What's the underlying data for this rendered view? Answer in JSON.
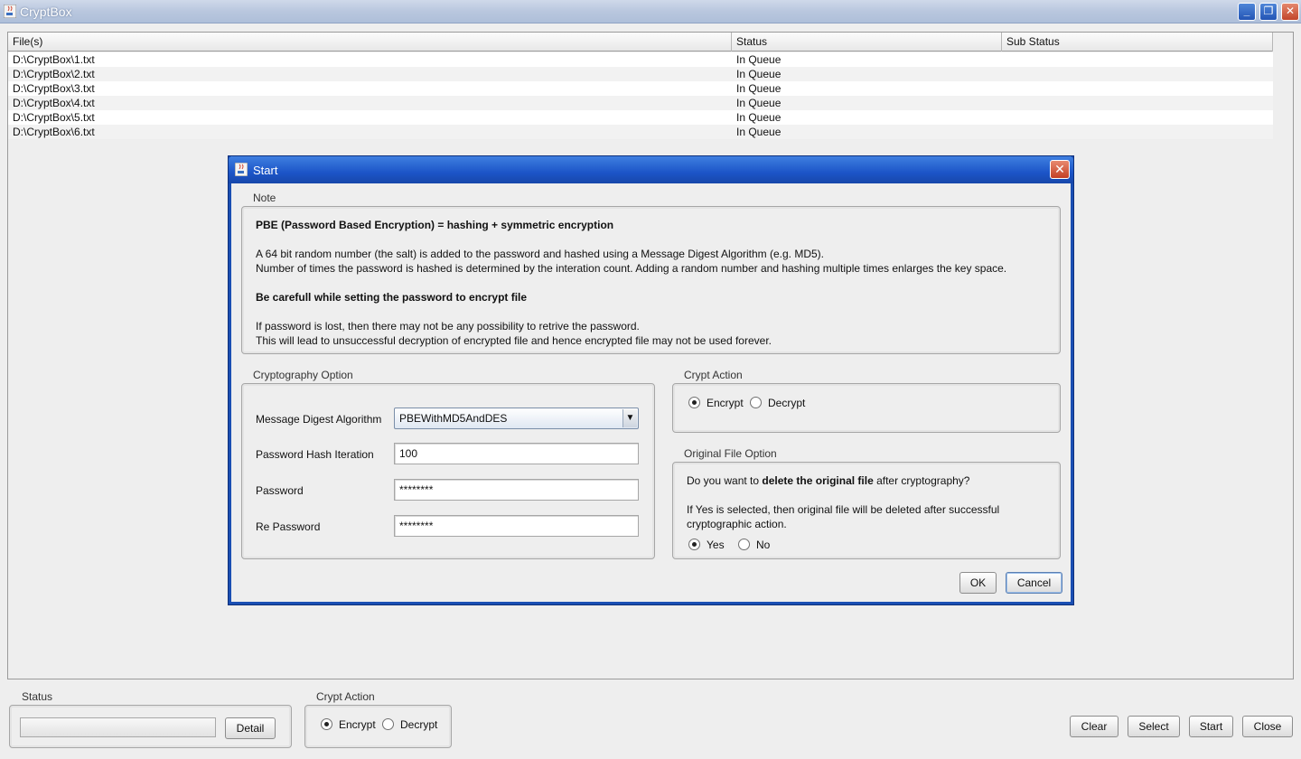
{
  "window": {
    "title": "CryptBox"
  },
  "table": {
    "headers": [
      "File(s)",
      "Status",
      "Sub Status"
    ],
    "rows": [
      {
        "file": "D:\\CryptBox\\1.txt",
        "status": "In Queue",
        "sub_status": ""
      },
      {
        "file": "D:\\CryptBox\\2.txt",
        "status": "In Queue",
        "sub_status": ""
      },
      {
        "file": "D:\\CryptBox\\3.txt",
        "status": "In Queue",
        "sub_status": ""
      },
      {
        "file": "D:\\CryptBox\\4.txt",
        "status": "In Queue",
        "sub_status": ""
      },
      {
        "file": "D:\\CryptBox\\5.txt",
        "status": "In Queue",
        "sub_status": ""
      },
      {
        "file": "D:\\CryptBox\\6.txt",
        "status": "In Queue",
        "sub_status": ""
      }
    ]
  },
  "dialog": {
    "title": "Start",
    "note": {
      "title": "Note",
      "heading1": "PBE (Password Based Encryption) = hashing + symmetric encryption",
      "line1": "A 64 bit random number (the salt) is added to the password and hashed using a Message Digest Algorithm (e.g. MD5).",
      "line2": "Number of times the password is hashed is determined by the interation count. Adding a random number and hashing multiple times enlarges the key space.",
      "heading2": "Be carefull while setting the password to encrypt file",
      "line3": "If password is lost, then there may not be any possibility to retrive the password.",
      "line4": "This will lead to unsuccessful decryption of encrypted file and hence encrypted file may not be used forever."
    },
    "crypto_option": {
      "title": "Cryptography Option",
      "algorithm_label": "Message Digest Algorithm",
      "algorithm_value": "PBEWithMD5AndDES",
      "iteration_label": "Password Hash Iteration",
      "iteration_value": "100",
      "password_label": "Password",
      "password_value": "********",
      "repassword_label": "Re Password",
      "repassword_value": "********"
    },
    "crypt_action": {
      "title": "Crypt Action",
      "encrypt_label": "Encrypt",
      "decrypt_label": "Decrypt",
      "selected": "encrypt"
    },
    "original_file_option": {
      "title": "Original File Option",
      "question_pre": "Do you want to ",
      "question_bold": "delete the original file",
      "question_post": " after cryptography?",
      "info_line1": "If Yes is selected, then original file will be deleted after successful",
      "info_line2": "cryptographic action.",
      "yes_label": "Yes",
      "no_label": "No",
      "selected": "yes"
    },
    "ok_label": "OK",
    "cancel_label": "Cancel"
  },
  "bottom": {
    "status": {
      "title": "Status",
      "detail_label": "Detail"
    },
    "crypt_action": {
      "title": "Crypt Action",
      "encrypt_label": "Encrypt",
      "decrypt_label": "Decrypt",
      "selected": "encrypt"
    },
    "buttons": {
      "clear": "Clear",
      "select": "Select",
      "start": "Start",
      "close": "Close"
    }
  },
  "icons": [
    "java-cup-icon",
    "minimize-icon",
    "restore-icon",
    "close-icon",
    "chevron-down-icon"
  ]
}
